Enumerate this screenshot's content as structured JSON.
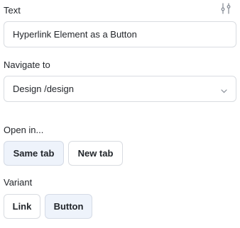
{
  "text_field": {
    "label": "Text",
    "value": "Hyperlink Element as a Button"
  },
  "navigate": {
    "label": "Navigate to",
    "value": "Design /design"
  },
  "open_in": {
    "label": "Open in...",
    "options": [
      "Same tab",
      "New tab"
    ],
    "selected": "Same tab"
  },
  "variant": {
    "label": "Variant",
    "options": [
      "Link",
      "Button"
    ],
    "selected": "Button"
  },
  "icons": {
    "settings": "sliders-settings-icon",
    "chevron": "chevron-down-icon"
  },
  "colors": {
    "active_bg": "#eef3fb",
    "border": "#d9dce1"
  }
}
